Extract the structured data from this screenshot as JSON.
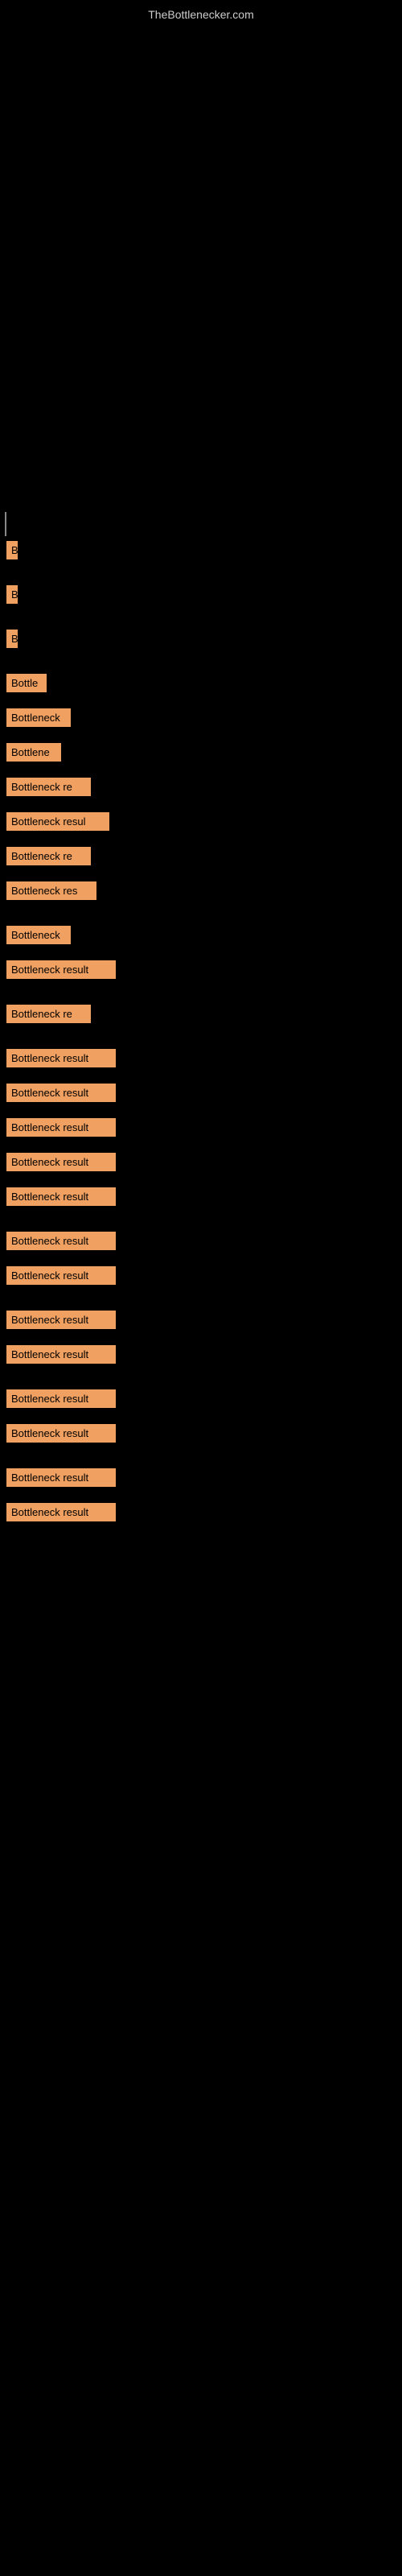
{
  "site": {
    "title": "TheBottlenecker.com"
  },
  "items": [
    {
      "id": 1,
      "label": "B",
      "width": 14
    },
    {
      "id": 2,
      "label": "B",
      "width": 14
    },
    {
      "id": 3,
      "label": "B",
      "width": 14
    },
    {
      "id": 4,
      "label": "Bottle",
      "width": 50
    },
    {
      "id": 5,
      "label": "Bottleneck",
      "width": 80
    },
    {
      "id": 6,
      "label": "Bottlene",
      "width": 68
    },
    {
      "id": 7,
      "label": "Bottleneck re",
      "width": 105
    },
    {
      "id": 8,
      "label": "Bottleneck resul",
      "width": 128
    },
    {
      "id": 9,
      "label": "Bottleneck re",
      "width": 105
    },
    {
      "id": 10,
      "label": "Bottleneck res",
      "width": 112
    },
    {
      "id": 11,
      "label": "Bottleneck",
      "width": 80
    },
    {
      "id": 12,
      "label": "Bottleneck result",
      "width": 136
    },
    {
      "id": 13,
      "label": "Bottleneck re",
      "width": 105
    },
    {
      "id": 14,
      "label": "Bottleneck result",
      "width": 136
    },
    {
      "id": 15,
      "label": "Bottleneck result",
      "width": 136
    },
    {
      "id": 16,
      "label": "Bottleneck result",
      "width": 136
    },
    {
      "id": 17,
      "label": "Bottleneck result",
      "width": 136
    },
    {
      "id": 18,
      "label": "Bottleneck result",
      "width": 136
    },
    {
      "id": 19,
      "label": "Bottleneck result",
      "width": 136
    },
    {
      "id": 20,
      "label": "Bottleneck result",
      "width": 136
    },
    {
      "id": 21,
      "label": "Bottleneck result",
      "width": 136
    },
    {
      "id": 22,
      "label": "Bottleneck result",
      "width": 136
    },
    {
      "id": 23,
      "label": "Bottleneck result",
      "width": 136
    },
    {
      "id": 24,
      "label": "Bottleneck result",
      "width": 136
    },
    {
      "id": 25,
      "label": "Bottleneck result",
      "width": 136
    },
    {
      "id": 26,
      "label": "Bottleneck result",
      "width": 136
    }
  ]
}
